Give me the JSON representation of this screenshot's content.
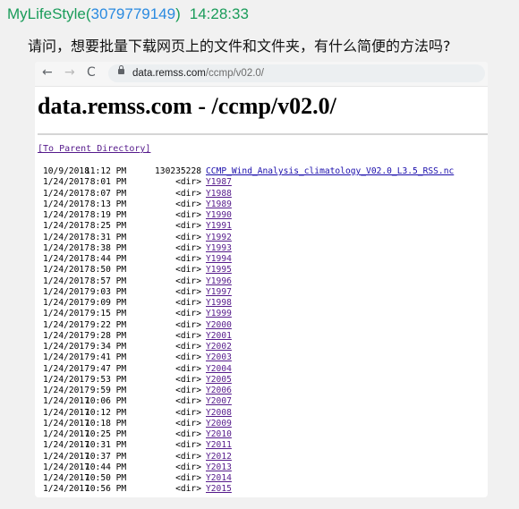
{
  "chat": {
    "sender": "MyLifeStyle",
    "uid": "3079779149",
    "time": "14:28:33",
    "message": "请问，想要批量下载网页上的文件和文件夹，有什么简便的方法吗?"
  },
  "browser": {
    "url_host": "data.remss.com",
    "url_path": "/ccmp/v02.0/",
    "page_title": "data.remss.com - /ccmp/v02.0/",
    "parent_link": "[To Parent Directory]",
    "listing": [
      {
        "date": "10/9/2018",
        "time": "11:12 PM",
        "size": "130235228",
        "name": "CCMP_Wind_Analysis_climatology_V02.0_L3.5_RSS.nc"
      },
      {
        "date": "1/24/2017",
        "time": " 8:01 PM",
        "size": "<dir>",
        "name": "Y1987"
      },
      {
        "date": "1/24/2017",
        "time": " 8:07 PM",
        "size": "<dir>",
        "name": "Y1988"
      },
      {
        "date": "1/24/2017",
        "time": " 8:13 PM",
        "size": "<dir>",
        "name": "Y1989"
      },
      {
        "date": "1/24/2017",
        "time": " 8:19 PM",
        "size": "<dir>",
        "name": "Y1990"
      },
      {
        "date": "1/24/2017",
        "time": " 8:25 PM",
        "size": "<dir>",
        "name": "Y1991"
      },
      {
        "date": "1/24/2017",
        "time": " 8:31 PM",
        "size": "<dir>",
        "name": "Y1992"
      },
      {
        "date": "1/24/2017",
        "time": " 8:38 PM",
        "size": "<dir>",
        "name": "Y1993"
      },
      {
        "date": "1/24/2017",
        "time": " 8:44 PM",
        "size": "<dir>",
        "name": "Y1994"
      },
      {
        "date": "1/24/2017",
        "time": " 8:50 PM",
        "size": "<dir>",
        "name": "Y1995"
      },
      {
        "date": "1/24/2017",
        "time": " 8:57 PM",
        "size": "<dir>",
        "name": "Y1996"
      },
      {
        "date": "1/24/2017",
        "time": " 9:03 PM",
        "size": "<dir>",
        "name": "Y1997"
      },
      {
        "date": "1/24/2017",
        "time": " 9:09 PM",
        "size": "<dir>",
        "name": "Y1998"
      },
      {
        "date": "1/24/2017",
        "time": " 9:15 PM",
        "size": "<dir>",
        "name": "Y1999"
      },
      {
        "date": "1/24/2017",
        "time": " 9:22 PM",
        "size": "<dir>",
        "name": "Y2000"
      },
      {
        "date": "1/24/2017",
        "time": " 9:28 PM",
        "size": "<dir>",
        "name": "Y2001"
      },
      {
        "date": "1/24/2017",
        "time": " 9:34 PM",
        "size": "<dir>",
        "name": "Y2002"
      },
      {
        "date": "1/24/2017",
        "time": " 9:41 PM",
        "size": "<dir>",
        "name": "Y2003"
      },
      {
        "date": "1/24/2017",
        "time": " 9:47 PM",
        "size": "<dir>",
        "name": "Y2004"
      },
      {
        "date": "1/24/2017",
        "time": " 9:53 PM",
        "size": "<dir>",
        "name": "Y2005"
      },
      {
        "date": "1/24/2017",
        "time": " 9:59 PM",
        "size": "<dir>",
        "name": "Y2006"
      },
      {
        "date": "1/24/2017",
        "time": "10:06 PM",
        "size": "<dir>",
        "name": "Y2007"
      },
      {
        "date": "1/24/2017",
        "time": "10:12 PM",
        "size": "<dir>",
        "name": "Y2008"
      },
      {
        "date": "1/24/2017",
        "time": "10:18 PM",
        "size": "<dir>",
        "name": "Y2009"
      },
      {
        "date": "1/24/2017",
        "time": "10:25 PM",
        "size": "<dir>",
        "name": "Y2010"
      },
      {
        "date": "1/24/2017",
        "time": "10:31 PM",
        "size": "<dir>",
        "name": "Y2011"
      },
      {
        "date": "1/24/2017",
        "time": "10:37 PM",
        "size": "<dir>",
        "name": "Y2012"
      },
      {
        "date": "1/24/2017",
        "time": "10:44 PM",
        "size": "<dir>",
        "name": "Y2013"
      },
      {
        "date": "1/24/2017",
        "time": "10:50 PM",
        "size": "<dir>",
        "name": "Y2014"
      },
      {
        "date": "1/24/2017",
        "time": "10:56 PM",
        "size": "<dir>",
        "name": "Y2015"
      }
    ]
  },
  "icons": {
    "back": "←",
    "forward": "→",
    "reload": "C"
  },
  "colors": {
    "sender": "#1a9c5a",
    "uid": "#2a8ae0",
    "visited_link": "#551a8b"
  }
}
